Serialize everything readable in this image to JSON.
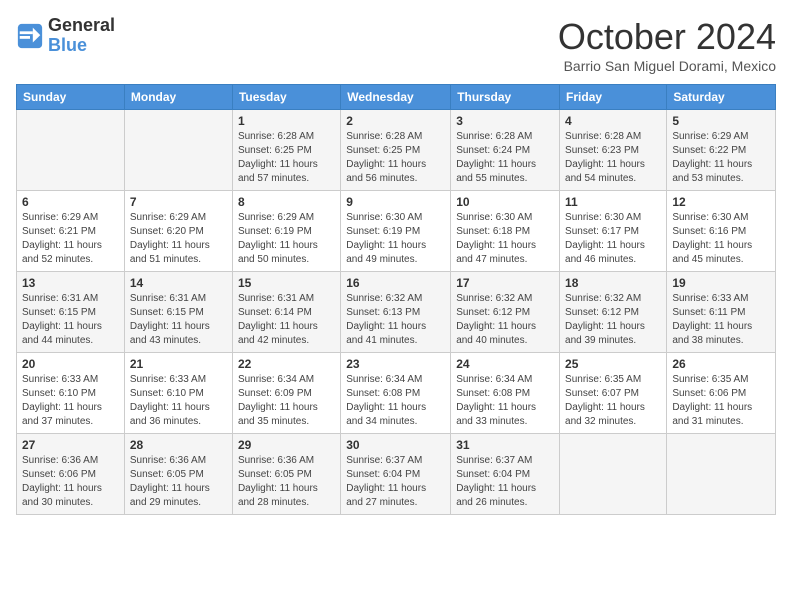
{
  "header": {
    "logo_line1": "General",
    "logo_line2": "Blue",
    "month": "October 2024",
    "location": "Barrio San Miguel Dorami, Mexico"
  },
  "days_of_week": [
    "Sunday",
    "Monday",
    "Tuesday",
    "Wednesday",
    "Thursday",
    "Friday",
    "Saturday"
  ],
  "weeks": [
    [
      {
        "day": "",
        "info": ""
      },
      {
        "day": "",
        "info": ""
      },
      {
        "day": "1",
        "info": "Sunrise: 6:28 AM\nSunset: 6:25 PM\nDaylight: 11 hours and 57 minutes."
      },
      {
        "day": "2",
        "info": "Sunrise: 6:28 AM\nSunset: 6:25 PM\nDaylight: 11 hours and 56 minutes."
      },
      {
        "day": "3",
        "info": "Sunrise: 6:28 AM\nSunset: 6:24 PM\nDaylight: 11 hours and 55 minutes."
      },
      {
        "day": "4",
        "info": "Sunrise: 6:28 AM\nSunset: 6:23 PM\nDaylight: 11 hours and 54 minutes."
      },
      {
        "day": "5",
        "info": "Sunrise: 6:29 AM\nSunset: 6:22 PM\nDaylight: 11 hours and 53 minutes."
      }
    ],
    [
      {
        "day": "6",
        "info": "Sunrise: 6:29 AM\nSunset: 6:21 PM\nDaylight: 11 hours and 52 minutes."
      },
      {
        "day": "7",
        "info": "Sunrise: 6:29 AM\nSunset: 6:20 PM\nDaylight: 11 hours and 51 minutes."
      },
      {
        "day": "8",
        "info": "Sunrise: 6:29 AM\nSunset: 6:19 PM\nDaylight: 11 hours and 50 minutes."
      },
      {
        "day": "9",
        "info": "Sunrise: 6:30 AM\nSunset: 6:19 PM\nDaylight: 11 hours and 49 minutes."
      },
      {
        "day": "10",
        "info": "Sunrise: 6:30 AM\nSunset: 6:18 PM\nDaylight: 11 hours and 47 minutes."
      },
      {
        "day": "11",
        "info": "Sunrise: 6:30 AM\nSunset: 6:17 PM\nDaylight: 11 hours and 46 minutes."
      },
      {
        "day": "12",
        "info": "Sunrise: 6:30 AM\nSunset: 6:16 PM\nDaylight: 11 hours and 45 minutes."
      }
    ],
    [
      {
        "day": "13",
        "info": "Sunrise: 6:31 AM\nSunset: 6:15 PM\nDaylight: 11 hours and 44 minutes."
      },
      {
        "day": "14",
        "info": "Sunrise: 6:31 AM\nSunset: 6:15 PM\nDaylight: 11 hours and 43 minutes."
      },
      {
        "day": "15",
        "info": "Sunrise: 6:31 AM\nSunset: 6:14 PM\nDaylight: 11 hours and 42 minutes."
      },
      {
        "day": "16",
        "info": "Sunrise: 6:32 AM\nSunset: 6:13 PM\nDaylight: 11 hours and 41 minutes."
      },
      {
        "day": "17",
        "info": "Sunrise: 6:32 AM\nSunset: 6:12 PM\nDaylight: 11 hours and 40 minutes."
      },
      {
        "day": "18",
        "info": "Sunrise: 6:32 AM\nSunset: 6:12 PM\nDaylight: 11 hours and 39 minutes."
      },
      {
        "day": "19",
        "info": "Sunrise: 6:33 AM\nSunset: 6:11 PM\nDaylight: 11 hours and 38 minutes."
      }
    ],
    [
      {
        "day": "20",
        "info": "Sunrise: 6:33 AM\nSunset: 6:10 PM\nDaylight: 11 hours and 37 minutes."
      },
      {
        "day": "21",
        "info": "Sunrise: 6:33 AM\nSunset: 6:10 PM\nDaylight: 11 hours and 36 minutes."
      },
      {
        "day": "22",
        "info": "Sunrise: 6:34 AM\nSunset: 6:09 PM\nDaylight: 11 hours and 35 minutes."
      },
      {
        "day": "23",
        "info": "Sunrise: 6:34 AM\nSunset: 6:08 PM\nDaylight: 11 hours and 34 minutes."
      },
      {
        "day": "24",
        "info": "Sunrise: 6:34 AM\nSunset: 6:08 PM\nDaylight: 11 hours and 33 minutes."
      },
      {
        "day": "25",
        "info": "Sunrise: 6:35 AM\nSunset: 6:07 PM\nDaylight: 11 hours and 32 minutes."
      },
      {
        "day": "26",
        "info": "Sunrise: 6:35 AM\nSunset: 6:06 PM\nDaylight: 11 hours and 31 minutes."
      }
    ],
    [
      {
        "day": "27",
        "info": "Sunrise: 6:36 AM\nSunset: 6:06 PM\nDaylight: 11 hours and 30 minutes."
      },
      {
        "day": "28",
        "info": "Sunrise: 6:36 AM\nSunset: 6:05 PM\nDaylight: 11 hours and 29 minutes."
      },
      {
        "day": "29",
        "info": "Sunrise: 6:36 AM\nSunset: 6:05 PM\nDaylight: 11 hours and 28 minutes."
      },
      {
        "day": "30",
        "info": "Sunrise: 6:37 AM\nSunset: 6:04 PM\nDaylight: 11 hours and 27 minutes."
      },
      {
        "day": "31",
        "info": "Sunrise: 6:37 AM\nSunset: 6:04 PM\nDaylight: 11 hours and 26 minutes."
      },
      {
        "day": "",
        "info": ""
      },
      {
        "day": "",
        "info": ""
      }
    ]
  ]
}
